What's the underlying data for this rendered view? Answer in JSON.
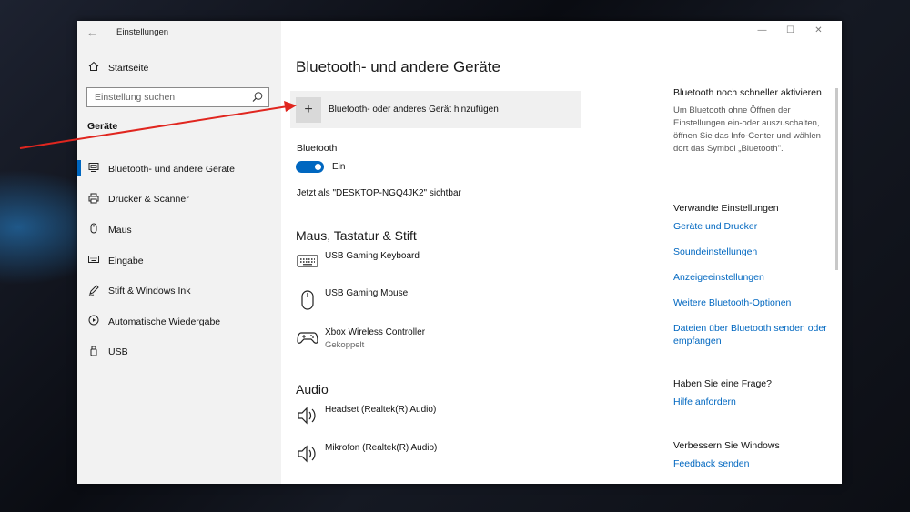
{
  "window": {
    "title": "Einstellungen",
    "back_glyph": "←",
    "minimize_glyph": "—",
    "maximize_glyph": "☐",
    "close_glyph": "✕"
  },
  "sidebar": {
    "home_label": "Startseite",
    "search_placeholder": "Einstellung suchen",
    "section_title": "Geräte",
    "items": [
      {
        "label": "Bluetooth- und andere Geräte",
        "icon": "bluetooth-devices-icon",
        "active": true
      },
      {
        "label": "Drucker & Scanner",
        "icon": "printer-icon"
      },
      {
        "label": "Maus",
        "icon": "mouse-icon"
      },
      {
        "label": "Eingabe",
        "icon": "keyboard-icon"
      },
      {
        "label": "Stift & Windows Ink",
        "icon": "pen-icon"
      },
      {
        "label": "Automatische Wiedergabe",
        "icon": "autoplay-icon"
      },
      {
        "label": "USB",
        "icon": "usb-icon"
      }
    ]
  },
  "main": {
    "title": "Bluetooth- und andere Geräte",
    "add_device": {
      "plus": "+",
      "label": "Bluetooth- oder anderes Gerät hinzufügen"
    },
    "bluetooth_label": "Bluetooth",
    "bluetooth_state": "Ein",
    "visible_as": "Jetzt als \"DESKTOP-NGQ4JK2\" sichtbar",
    "groups": {
      "input_title": "Maus, Tastatur & Stift",
      "input_devices": [
        {
          "name": "USB Gaming Keyboard",
          "status": "",
          "icon": "keyboard-icon"
        },
        {
          "name": "USB Gaming Mouse",
          "status": "",
          "icon": "mouse-icon"
        },
        {
          "name": "Xbox Wireless Controller",
          "status": "Gekoppelt",
          "icon": "gamepad-icon"
        }
      ],
      "audio_title": "Audio",
      "audio_devices": [
        {
          "name": "Headset (Realtek(R) Audio)",
          "icon": "speaker-icon"
        },
        {
          "name": "Mikrofon (Realtek(R) Audio)",
          "icon": "speaker-icon"
        }
      ]
    }
  },
  "right": {
    "quick_title": "Bluetooth noch schneller aktivieren",
    "quick_text": "Um Bluetooth ohne Öffnen der Einstellungen ein-oder auszuschalten, öffnen Sie das Info-Center und wählen dort das Symbol „Bluetooth\".",
    "related_title": "Verwandte Einstellungen",
    "related_links": [
      "Geräte und Drucker",
      "Soundeinstellungen",
      "Anzeigeeinstellungen",
      "Weitere Bluetooth-Optionen",
      "Dateien über Bluetooth senden oder empfangen"
    ],
    "question_title": "Haben Sie eine Frage?",
    "question_link": "Hilfe anfordern",
    "improve_title": "Verbessern Sie Windows",
    "improve_link": "Feedback senden"
  },
  "colors": {
    "accent": "#0067c0",
    "annotation_arrow": "#e0261f",
    "sidebar_bg": "#f2f2f2"
  }
}
